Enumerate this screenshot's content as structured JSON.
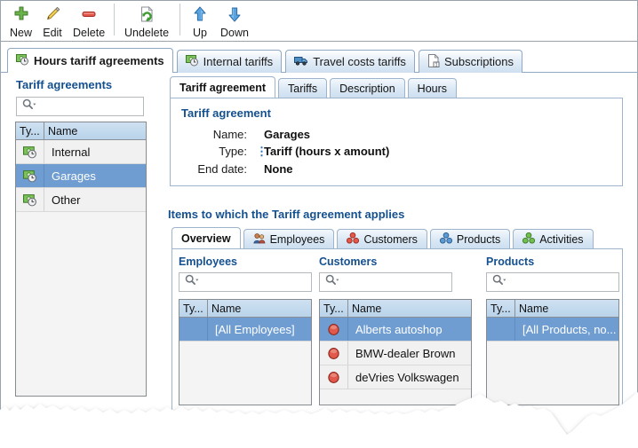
{
  "toolbar": {
    "buttons": [
      {
        "label": "New",
        "icon": "plus-icon"
      },
      {
        "label": "Edit",
        "icon": "pencil-icon"
      },
      {
        "label": "Delete",
        "icon": "minus-icon"
      },
      {
        "label": "Undelete",
        "icon": "undelete-icon"
      },
      {
        "label": "Up",
        "icon": "arrow-up-icon"
      },
      {
        "label": "Down",
        "icon": "arrow-down-icon"
      }
    ]
  },
  "main_tabs": [
    {
      "label": "Hours tariff agreements",
      "icon": "money-clock-icon",
      "active": true
    },
    {
      "label": "Internal tariffs",
      "icon": "money-clock-icon",
      "active": false
    },
    {
      "label": "Travel costs tariffs",
      "icon": "truck-icon",
      "active": false
    },
    {
      "label": "Subscriptions",
      "icon": "document-one-icon",
      "active": false
    }
  ],
  "left_panel": {
    "title": "Tariff agreements",
    "search": {
      "value": "",
      "placeholder": ""
    },
    "columns": [
      "Ty...",
      "Name"
    ],
    "rows": [
      {
        "name": "Internal",
        "icon": "money-clock-icon",
        "selected": false
      },
      {
        "name": "Garages",
        "icon": "money-clock-icon",
        "selected": true
      },
      {
        "name": "Other",
        "icon": "money-clock-icon",
        "selected": false
      }
    ]
  },
  "detail": {
    "tabs": [
      {
        "label": "Tariff agreement",
        "active": true
      },
      {
        "label": "Tariffs",
        "active": false
      },
      {
        "label": "Description",
        "active": false
      },
      {
        "label": "Hours",
        "active": false
      }
    ],
    "group_title": "Tariff agreement",
    "fields": [
      {
        "label": "Name:",
        "value": "Garages",
        "marker": ""
      },
      {
        "label": "Type:",
        "value": "Tariff (hours x amount)",
        "marker": "⋮"
      },
      {
        "label": "End date:",
        "value": "None",
        "marker": ""
      }
    ]
  },
  "items_section": {
    "title": "Items to which the Tariff agreement applies",
    "tabs": [
      {
        "label": "Overview",
        "icon": "",
        "active": true
      },
      {
        "label": "Employees",
        "icon": "employees-icon",
        "active": false
      },
      {
        "label": "Customers",
        "icon": "customers-icon",
        "active": false
      },
      {
        "label": "Products",
        "icon": "products-icon",
        "active": false
      },
      {
        "label": "Activities",
        "icon": "activities-icon",
        "active": false
      }
    ],
    "columns": [
      {
        "title": "Employees",
        "search": {
          "value": "",
          "placeholder": ""
        },
        "headers": [
          "Ty...",
          "Name"
        ],
        "rows": [
          {
            "name": "[All Employees]",
            "icon": "none",
            "selected": true
          }
        ]
      },
      {
        "title": "Customers",
        "search": {
          "value": "",
          "placeholder": ""
        },
        "headers": [
          "Ty...",
          "Name"
        ],
        "rows": [
          {
            "name": "Alberts autoshop",
            "icon": "red-ball-icon",
            "selected": true
          },
          {
            "name": "BMW-dealer Brown",
            "icon": "red-ball-icon",
            "selected": false
          },
          {
            "name": "deVries Volkswagen",
            "icon": "red-ball-icon",
            "selected": false
          }
        ]
      },
      {
        "title": "Products",
        "search": {
          "value": "",
          "placeholder": ""
        },
        "headers": [
          "Ty...",
          "Name"
        ],
        "rows": [
          {
            "name": "[All Products, no...",
            "icon": "none",
            "selected": true
          }
        ]
      }
    ]
  },
  "colors": {
    "accent_blue": "#15508f",
    "selection": "#6f9dd1",
    "tab_border": "#8fa8c4",
    "frame": "#9aa3ad"
  }
}
